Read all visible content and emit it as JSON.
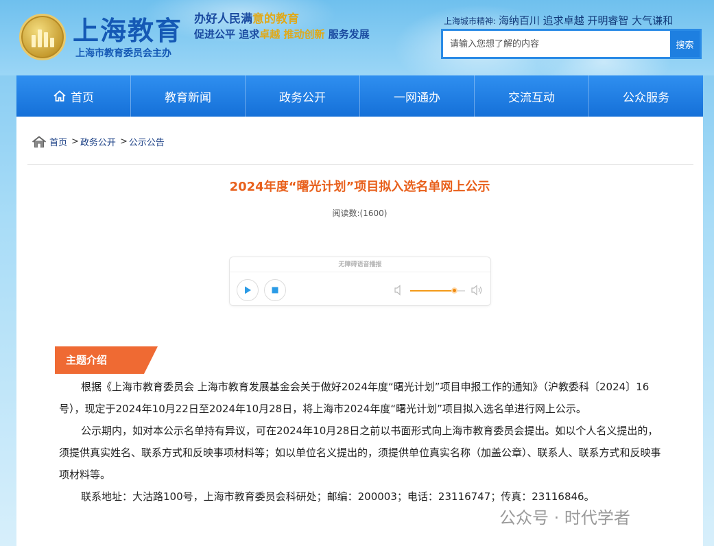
{
  "header": {
    "logo_title": "上海教育",
    "logo_subtitle": "上海市教育委员会主办",
    "slogan_line1_a": "办好人民满",
    "slogan_line1_b": "意的教育",
    "slogan_line2_a": "促进公平 追求",
    "slogan_line2_b": "卓越 推动创新",
    "slogan_line2_c": " 服务发展",
    "city_spirit_label": "上海城市精神:",
    "city_spirit_text": "海纳百川 追求卓越 开明睿智 大气谦和",
    "search_placeholder": "请输入您想了解的内容",
    "search_button": "搜索",
    "accent_color": "#1e7fe0"
  },
  "nav": {
    "items": [
      {
        "label": "首页",
        "icon": "home-icon"
      },
      {
        "label": "教育新闻"
      },
      {
        "label": "政务公开"
      },
      {
        "label": "一网通办"
      },
      {
        "label": "交流互动"
      },
      {
        "label": "公众服务"
      }
    ]
  },
  "breadcrumb": {
    "home": "首页",
    "level1": "政务公开",
    "level2": "公示公告",
    "separator": ">"
  },
  "article": {
    "title": "2024年度“曙光计划”项目拟入选名单网上公示",
    "read_count": "阅读数:(1600)",
    "title_color": "#e8601c"
  },
  "player": {
    "title": "无障碍语音播报",
    "volume_level": 0.8
  },
  "section": {
    "tag_label": "主题介绍",
    "tag_color": "#ef6a33"
  },
  "body": {
    "p1": "根据《上海市教育委员会 上海市教育发展基金会关于做好2024年度“曙光计划”项目申报工作的通知》（沪教委科〔2024〕16号），现定于2024年10月22日至2024年10月28日，将上海市2024年度“曙光计划”项目拟入选名单进行网上公示。",
    "p2": "公示期内，如对本公示名单持有异议，可在2024年10月28日之前以书面形式向上海市教育委员会提出。如以个人名义提出的，须提供真实姓名、联系方式和反映事项材料等；如以单位名义提出的，须提供单位真实名称（加盖公章）、联系人、联系方式和反映事项材料等。",
    "p3": "联系地址：大沽路100号，上海市教育委员会科研处；邮编：200003；电话：23116747；传真：23116846。"
  },
  "watermark": {
    "text": "公众号 · 时代学者"
  }
}
